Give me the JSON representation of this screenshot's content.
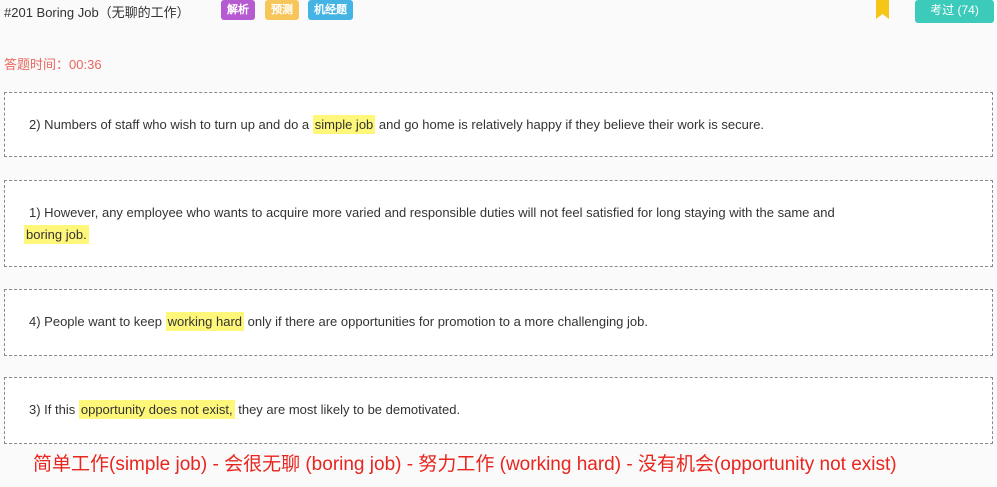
{
  "header": {
    "title": "#201 Boring Job（无聊的工作）",
    "tags": [
      "解析",
      "预测",
      "机经题"
    ],
    "exam_button": "考过 (74)"
  },
  "timer": {
    "label": "答题时间：",
    "value": "00:36"
  },
  "cards": [
    {
      "index": "2)",
      "before": " Numbers of staff who wish to turn up and do a ",
      "highlight": "simple job",
      "after": " and go home is relatively happy if they believe their work is secure."
    },
    {
      "index": "1)",
      "before": " However, any employee who wants to acquire more varied and responsible duties will not feel satisfied for long staying with the same and",
      "highlight": "boring job.",
      "after": ""
    },
    {
      "index": "4)",
      "before": " People want to keep ",
      "highlight": "working hard",
      "after": " only if there are opportunities for promotion to a more challenging job."
    },
    {
      "index": "3)",
      "before": " If this ",
      "highlight": "opportunity does not exist,",
      "after": " they are most likely to be demotivated."
    }
  ],
  "summary": "简单工作(simple job) - 会很无聊 (boring job) - 努力工作 (working hard) - 没有机会(opportunity not exist)",
  "colors": {
    "tag_analysis": "#b65ad2",
    "tag_predict": "#f7c65b",
    "tag_machine": "#45b3e3",
    "exam_button": "#3ccaba",
    "bookmark": "#f5c518",
    "timer": "#e8685f",
    "highlight": "#fff77a",
    "summary": "#e8261f"
  },
  "icons": {
    "bookmark": "bookmark-icon"
  }
}
